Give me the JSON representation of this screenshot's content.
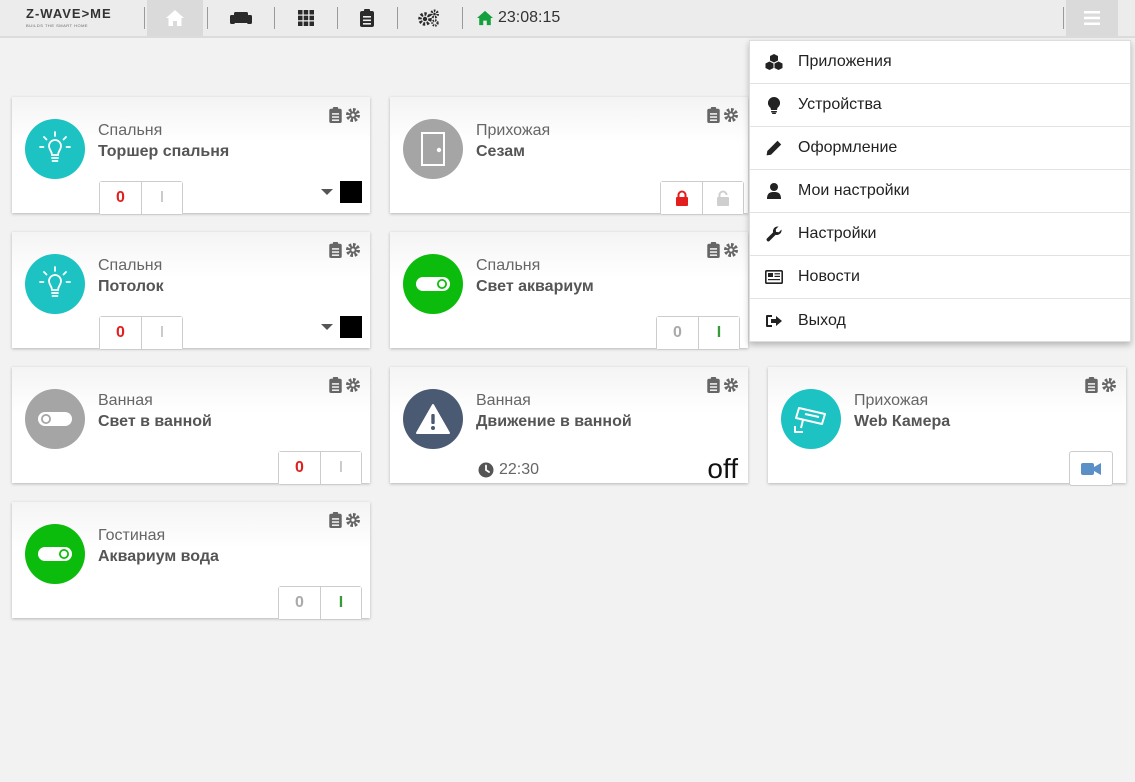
{
  "header": {
    "logo_text": "Z-WAVE>ME",
    "logo_tagline": "BUILDS THE SMART HOME",
    "time": "23:08:15",
    "nav": [
      "home-icon",
      "sofa-icon",
      "grid-icon",
      "clipboard-icon",
      "gears-icon"
    ]
  },
  "colors": {
    "accent_teal": "#1dc2c3",
    "green": "#0cbc0c",
    "gray": "#a5a5a5",
    "navy": "#4b5a73",
    "red": "#e21e1e",
    "blue": "#5a8fc7"
  },
  "cards": [
    {
      "room": "Спальня",
      "name": "Торшер спальня",
      "off": "0",
      "on": "I"
    },
    {
      "room": "Прихожая",
      "name": "Сезам"
    },
    {
      "room": "Спальня",
      "name": "Потолок",
      "off": "0",
      "on": "I"
    },
    {
      "room": "Спальня",
      "name": "Свет аквариум",
      "off": "0",
      "on": "I"
    },
    {
      "room": "Ванная",
      "name": "Свет в ванной",
      "off": "0",
      "on": "I"
    },
    {
      "room": "Ванная",
      "name": "Движение в ванной",
      "time": "22:30",
      "level": "off"
    },
    {
      "room": "Прихожая",
      "name": "Web Камера"
    },
    {
      "room": "Гостиная",
      "name": "Аквариум вода",
      "off": "0",
      "on": "I"
    }
  ],
  "menu": {
    "items": [
      {
        "label": "Приложения",
        "icon": "cubes-icon"
      },
      {
        "label": "Устройства",
        "icon": "lightbulb-icon"
      },
      {
        "label": "Оформление",
        "icon": "pencil-icon"
      },
      {
        "label": "Мои настройки",
        "icon": "user-icon"
      },
      {
        "label": "Настройки",
        "icon": "wrench-icon"
      },
      {
        "label": "Новости",
        "icon": "newspaper-icon"
      },
      {
        "label": "Выход",
        "icon": "sign-out-icon"
      }
    ]
  }
}
